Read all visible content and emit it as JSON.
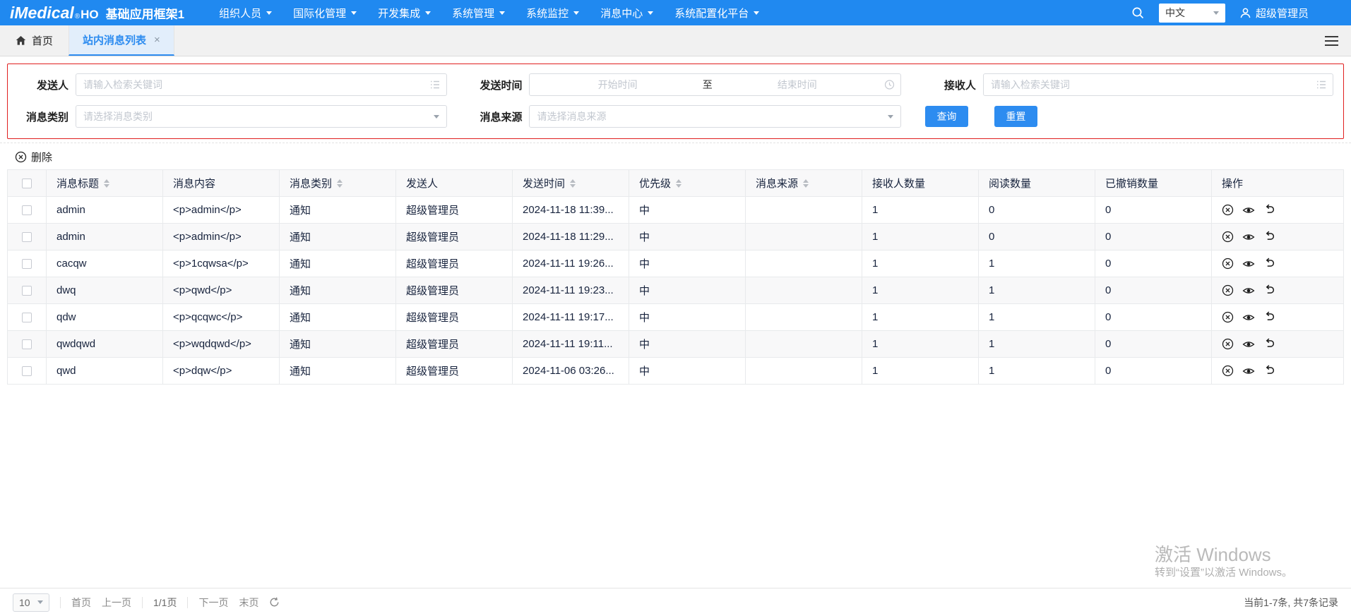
{
  "colors": {
    "primary": "#2d8cf0",
    "topbar": "#2089f0",
    "panel_border": "#e01f1f"
  },
  "header": {
    "logo": "iMedical",
    "logo_reg": "®",
    "logo_suffix": "HO",
    "app_title": "基础应用框架1",
    "nav_items": [
      "组织人员",
      "国际化管理",
      "开发集成",
      "系统管理",
      "系统监控",
      "消息中心",
      "系统配置化平台"
    ],
    "language": "中文",
    "user": "超级管理员"
  },
  "tabs": {
    "home_label": "首页",
    "active_label": "站内消息列表",
    "close_glyph": "×"
  },
  "filters": {
    "sender_label": "发送人",
    "sender_placeholder": "请输入检索关键词",
    "send_time_label": "发送时间",
    "start_placeholder": "开始时间",
    "range_separator": "至",
    "end_placeholder": "结束时间",
    "receiver_label": "接收人",
    "receiver_placeholder": "请输入检索关键词",
    "category_label": "消息类别",
    "category_placeholder": "请选择消息类别",
    "source_label": "消息来源",
    "source_placeholder": "请选择消息来源",
    "search_button": "查询",
    "reset_button": "重置"
  },
  "toolbar": {
    "delete_label": "删除"
  },
  "table": {
    "columns": [
      {
        "label": "消息标题",
        "sortable": true
      },
      {
        "label": "消息内容",
        "sortable": false
      },
      {
        "label": "消息类别",
        "sortable": true
      },
      {
        "label": "发送人",
        "sortable": false
      },
      {
        "label": "发送时间",
        "sortable": true
      },
      {
        "label": "优先级",
        "sortable": true
      },
      {
        "label": "消息来源",
        "sortable": true
      },
      {
        "label": "接收人数量",
        "sortable": false
      },
      {
        "label": "阅读数量",
        "sortable": false
      },
      {
        "label": "已撤销数量",
        "sortable": false
      },
      {
        "label": "操作",
        "sortable": false
      }
    ],
    "op_buttons": [
      {
        "button": "revoke-button",
        "icon": "circle-x-icon"
      },
      {
        "button": "view-button",
        "icon": "eye-icon"
      },
      {
        "button": "recall-button",
        "icon": "undo-icon"
      }
    ],
    "rows": [
      {
        "title": "admin",
        "content": "<p>admin</p>",
        "category": "通知",
        "sender": "超级管理员",
        "time": "2024-11-18 11:39...",
        "priority": "中",
        "source": "",
        "receivers": "1",
        "reads": "0",
        "revoked": "0"
      },
      {
        "title": "admin",
        "content": "<p>admin</p>",
        "category": "通知",
        "sender": "超级管理员",
        "time": "2024-11-18 11:29...",
        "priority": "中",
        "source": "",
        "receivers": "1",
        "reads": "0",
        "revoked": "0"
      },
      {
        "title": "cacqw",
        "content": "<p>1cqwsa</p>",
        "category": "通知",
        "sender": "超级管理员",
        "time": "2024-11-11 19:26...",
        "priority": "中",
        "source": "",
        "receivers": "1",
        "reads": "1",
        "revoked": "0"
      },
      {
        "title": "dwq",
        "content": "<p>qwd</p>",
        "category": "通知",
        "sender": "超级管理员",
        "time": "2024-11-11 19:23...",
        "priority": "中",
        "source": "",
        "receivers": "1",
        "reads": "1",
        "revoked": "0"
      },
      {
        "title": "qdw",
        "content": "<p>qcqwc</p>",
        "category": "通知",
        "sender": "超级管理员",
        "time": "2024-11-11 19:17...",
        "priority": "中",
        "source": "",
        "receivers": "1",
        "reads": "1",
        "revoked": "0"
      },
      {
        "title": "qwdqwd",
        "content": "<p>wqdqwd</p>",
        "category": "通知",
        "sender": "超级管理员",
        "time": "2024-11-11 19:11...",
        "priority": "中",
        "source": "",
        "receivers": "1",
        "reads": "1",
        "revoked": "0"
      },
      {
        "title": "qwd",
        "content": "<p>dqw</p>",
        "category": "通知",
        "sender": "超级管理员",
        "time": "2024-11-06 03:26...",
        "priority": "中",
        "source": "",
        "receivers": "1",
        "reads": "1",
        "revoked": "0"
      }
    ]
  },
  "pagination": {
    "page_size": "10",
    "first_label": "首页",
    "prev_label": "上一页",
    "page_info": "1/1页",
    "next_label": "下一页",
    "last_label": "末页",
    "summary": "当前1-7条, 共7条记录"
  },
  "watermark": {
    "line1": "激活 Windows",
    "line2": "转到“设置”以激活 Windows。"
  }
}
